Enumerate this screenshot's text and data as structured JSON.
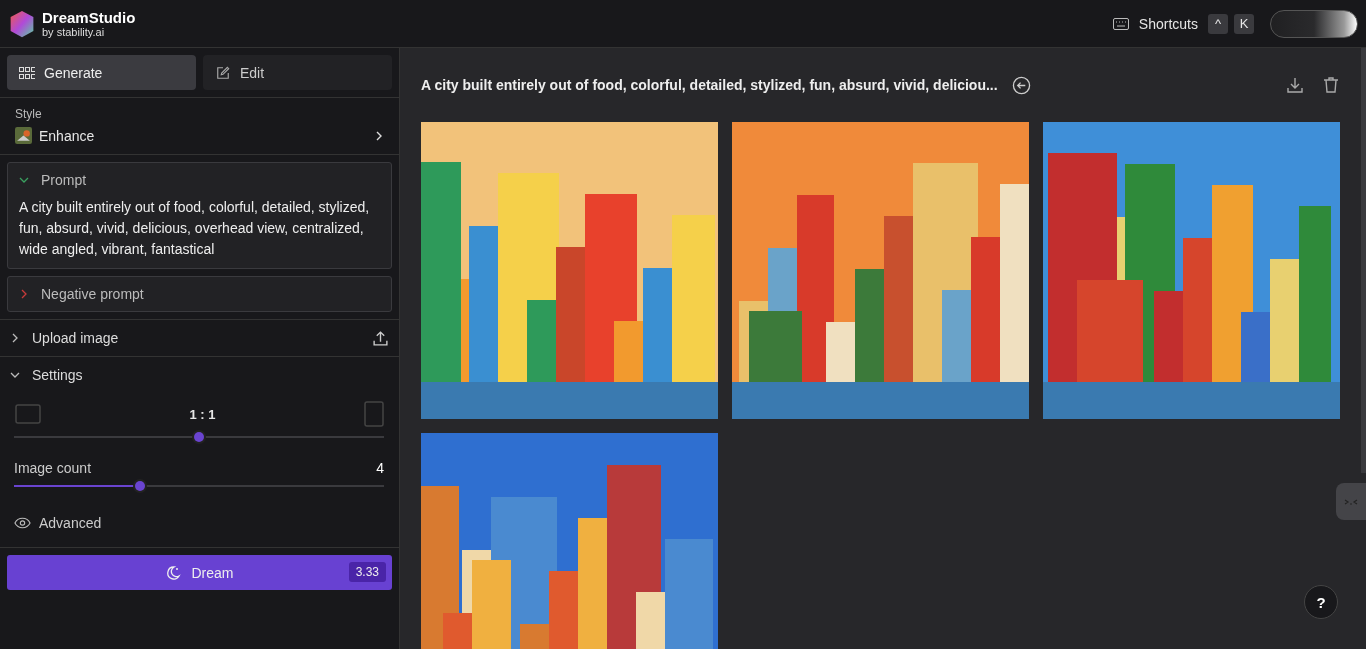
{
  "header": {
    "logo_title": "DreamStudio",
    "logo_subtitle": "by stability.ai",
    "shortcuts_label": "Shortcuts",
    "shortcut_keys": [
      "^",
      "K"
    ]
  },
  "sidebar": {
    "tabs": [
      {
        "label": "Generate",
        "selected": true,
        "kind": "grid"
      },
      {
        "label": "Edit",
        "selected": false,
        "kind": "edit"
      }
    ],
    "style": {
      "label": "Style",
      "value": "Enhance"
    },
    "prompt": {
      "title": "Prompt",
      "expanded": true,
      "text": "A city built entirely out of food, colorful, detailed, stylized, fun, absurd, vivid, delicious, overhead view, centralized, wide angled, vibrant, fantastical"
    },
    "negative_prompt": {
      "title": "Negative prompt",
      "expanded": false
    },
    "upload": {
      "title": "Upload image",
      "expanded": false
    },
    "settings": {
      "title": "Settings",
      "expanded": true,
      "aspect_ratio": {
        "value": "1 : 1",
        "level": 0.5
      },
      "image_count": {
        "label": "Image count",
        "value": "4",
        "level": 0.34
      },
      "advanced": "Advanced"
    },
    "dream_button": {
      "label": "Dream",
      "cost": "3.33"
    }
  },
  "main": {
    "prompt_title": "A city built entirely out of food, colorful, detailed, stylized, fun, absurd, vivid, deliciou...",
    "help": "?"
  }
}
